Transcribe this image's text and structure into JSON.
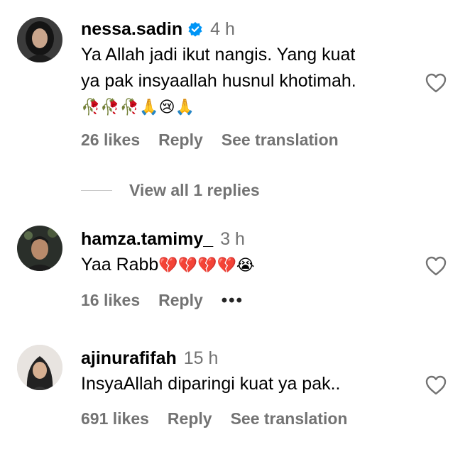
{
  "comments": [
    {
      "username": "nessa.sadin",
      "verified": true,
      "time": "4 h",
      "lines": [
        "Ya Allah jadi ikut nangis. Yang kuat",
        "ya pak insyaallah husnul khotimah."
      ],
      "emoji_line": "🥀🥀🥀🙏😢🙏",
      "likes": "26 likes",
      "reply": "Reply",
      "translate": "See translation",
      "view_replies": "View all 1 replies",
      "icons": {
        "like": "heart-outline-icon",
        "verified": "verified-badge-icon"
      }
    },
    {
      "username": "hamza.tamimy_",
      "time": "3 h",
      "text": "Yaa Rabb",
      "emoji": "💔💔💔💔😭",
      "likes": "16 likes",
      "reply": "Reply",
      "more": "•••",
      "icons": {
        "like": "heart-outline-icon",
        "more": "more-options-icon"
      }
    },
    {
      "username": "ajinurafifah",
      "time": "15 h",
      "text": "InsyaAllah diparingi kuat ya pak..",
      "likes": "691 likes",
      "reply": "Reply",
      "translate": "See translation",
      "icons": {
        "like": "heart-outline-icon"
      }
    }
  ],
  "colors": {
    "muted": "#737373",
    "verified": "#0095f6",
    "text": "#000000"
  }
}
